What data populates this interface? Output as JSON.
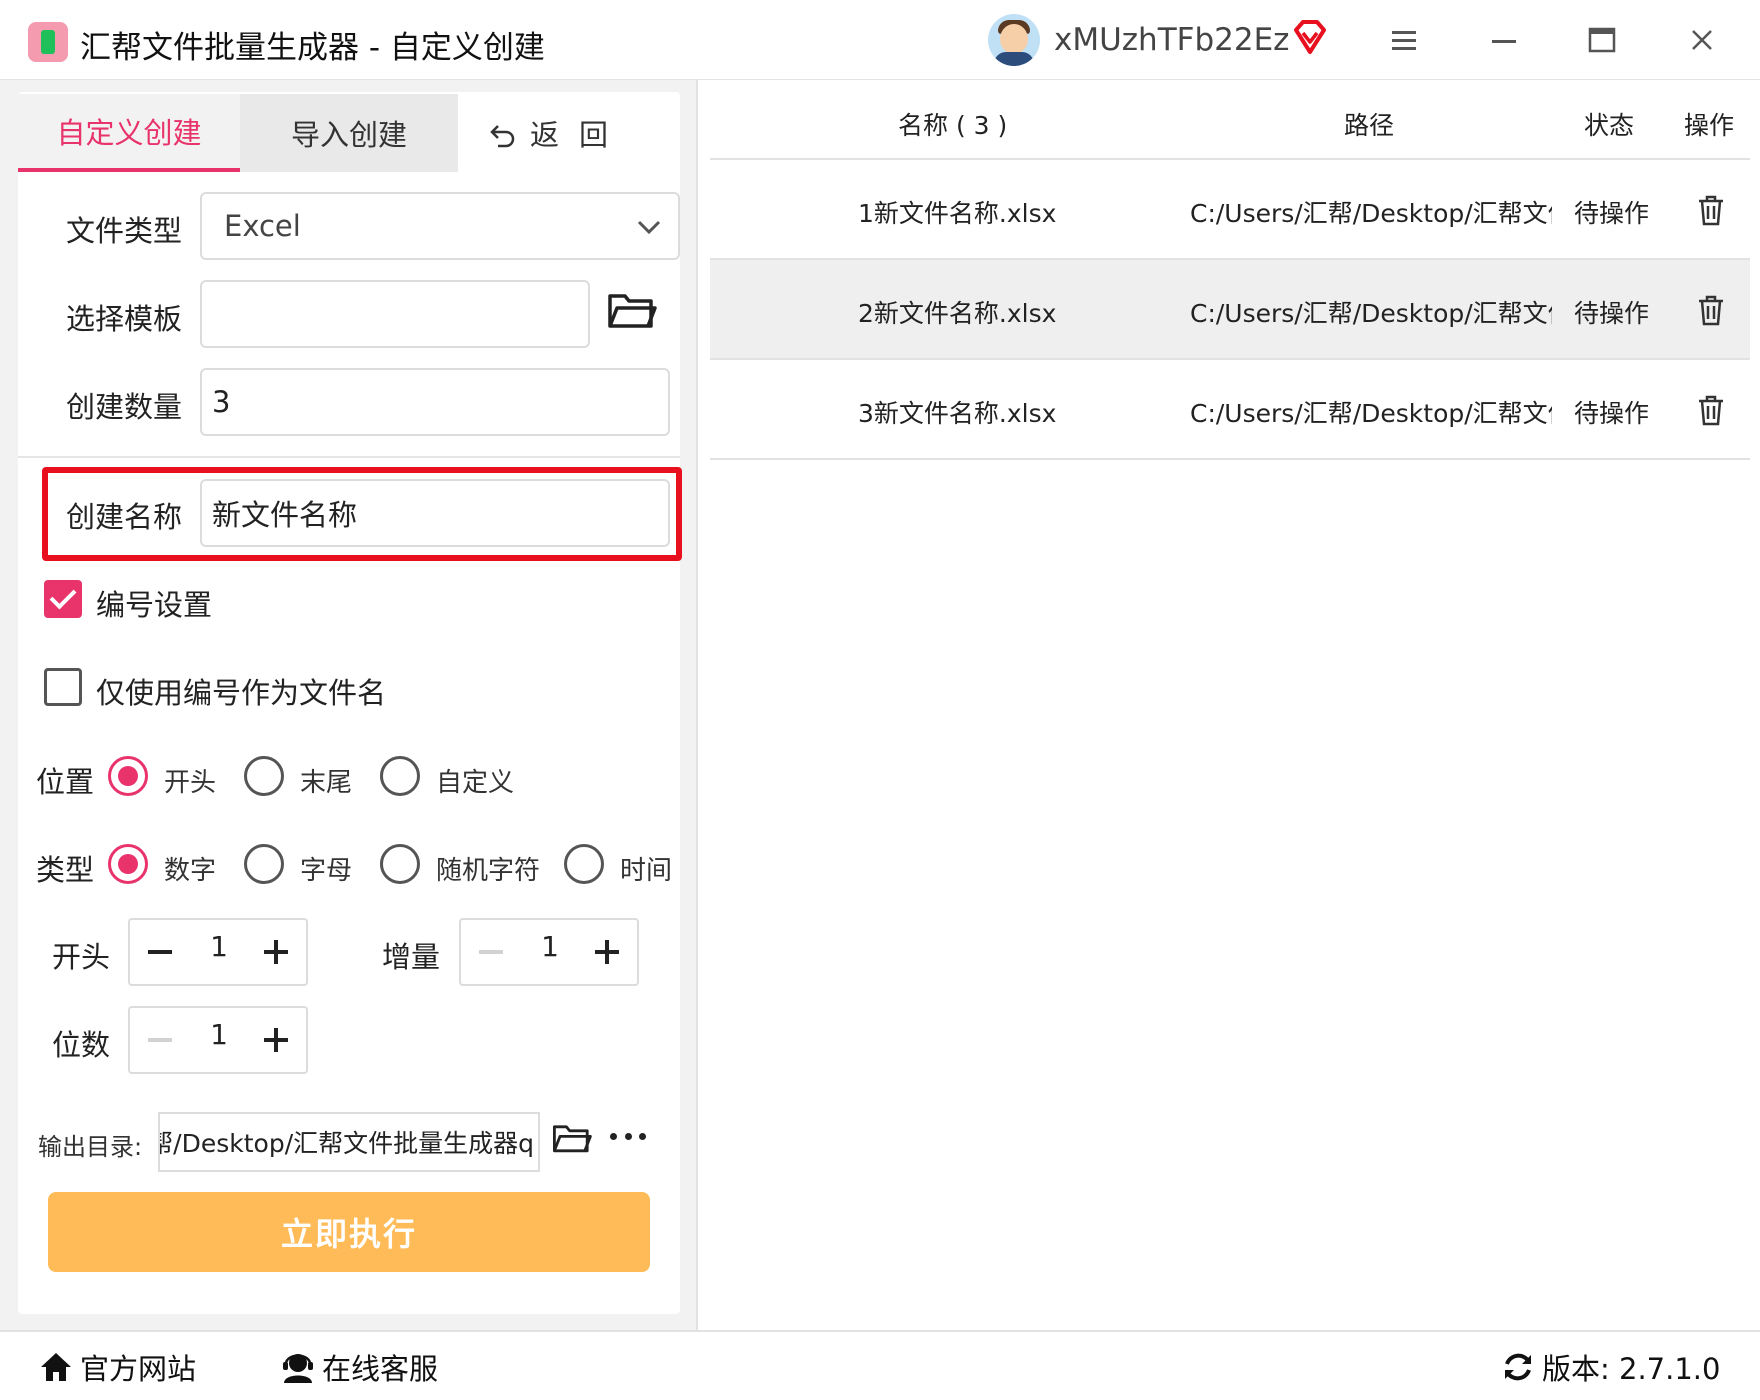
{
  "window": {
    "title": "汇帮文件批量生成器 - 自定义创建",
    "username": "xMUzhTFb22Ez"
  },
  "tabs": {
    "custom": "自定义创建",
    "import": "导入创建",
    "back": "返回"
  },
  "form": {
    "file_type_label": "文件类型",
    "file_type_value": "Excel",
    "template_label": "选择模板",
    "template_value": "",
    "count_label": "创建数量",
    "count_value": "3",
    "name_label": "创建名称",
    "name_value": "新文件名称",
    "numbering_label": "编号设置",
    "numbering_checked": true,
    "only_number_label": "仅使用编号作为文件名",
    "only_number_checked": false,
    "position_label": "位置",
    "position_options": [
      "开头",
      "末尾",
      "自定义"
    ],
    "position_selected": "开头",
    "type_label": "类型",
    "type_options": [
      "数字",
      "字母",
      "随机字符",
      "时间"
    ],
    "type_selected": "数字",
    "start_label": "开头",
    "start_value": "1",
    "increment_label": "增量",
    "increment_value": "1",
    "digits_label": "位数",
    "digits_value": "1",
    "output_label": "输出目录:",
    "output_value": "帮/Desktop/汇帮文件批量生成器q",
    "execute_label": "立即执行"
  },
  "table": {
    "headers": {
      "name": "名称 ( 3 )",
      "path": "路径",
      "status": "状态",
      "action": "操作"
    },
    "rows": [
      {
        "name": "1新文件名称.xlsx",
        "path": "C:/Users/汇帮/Desktop/汇帮文件",
        "status": "待操作"
      },
      {
        "name": "2新文件名称.xlsx",
        "path": "C:/Users/汇帮/Desktop/汇帮文件",
        "status": "待操作"
      },
      {
        "name": "3新文件名称.xlsx",
        "path": "C:/Users/汇帮/Desktop/汇帮文件",
        "status": "待操作"
      }
    ]
  },
  "statusbar": {
    "website": "官方网站",
    "support": "在线客服",
    "version": "版本:  2.7.1.0"
  },
  "icons": {
    "app": "app-icon",
    "vip": "diamond-icon",
    "menu": "menu-icon",
    "minimize": "minimize-icon",
    "maximize": "maximize-icon",
    "close": "close-icon",
    "back": "undo-icon",
    "folder": "folder-icon",
    "trash": "trash-icon",
    "home": "home-icon",
    "support": "headset-icon",
    "refresh": "refresh-icon"
  },
  "colors": {
    "accent": "#e8336b",
    "execute_button": "#ffbb57",
    "highlight_border": "#e8101e"
  }
}
